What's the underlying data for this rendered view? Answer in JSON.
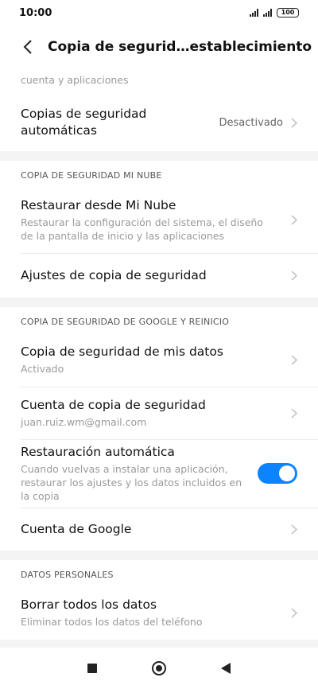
{
  "status_bar": {
    "time": "10:00",
    "battery": "100"
  },
  "header": {
    "title": "Copia de segurid…establecimiento"
  },
  "top_partial": {
    "subtitle_fragment": "cuenta y aplicaciones"
  },
  "auto_backup": {
    "title": "Copias de seguridad automáticas",
    "value": "Desactivado"
  },
  "mi_cloud": {
    "header": "COPIA DE SEGURIDAD MI NUBE",
    "restore": {
      "title": "Restaurar desde Mi Nube",
      "subtitle": "Restaurar la configuración del sistema, el diseño de la pantalla de inicio y las aplicaciones"
    },
    "settings": {
      "title": "Ajustes de copia de seguridad"
    }
  },
  "google": {
    "header": "COPIA DE SEGURIDAD DE GOOGLE Y REINICIO",
    "backup_data": {
      "title": "Copia de seguridad de mis datos",
      "subtitle": "Activado"
    },
    "backup_account": {
      "title": "Cuenta de copia de seguridad",
      "subtitle": "juan.ruiz.wm@gmail.com"
    },
    "auto_restore": {
      "title": "Restauración automática",
      "subtitle": "Cuando vuelvas a instalar una aplicación, restaurar los ajustes y los datos incluidos en la copia",
      "enabled": true,
      "toggle_color": "#0d84ff"
    },
    "google_account": {
      "title": "Cuenta de Google"
    }
  },
  "personal": {
    "header": "DATOS PERSONALES",
    "erase": {
      "title": "Borrar todos los datos",
      "subtitle": "Eliminar todos los datos del teléfono"
    }
  },
  "icons": {
    "back": "chevron-left-icon",
    "chevron": "chevron-right-icon",
    "nav_recents": "square-icon",
    "nav_home": "circle-icon",
    "nav_back": "triangle-back-icon"
  }
}
